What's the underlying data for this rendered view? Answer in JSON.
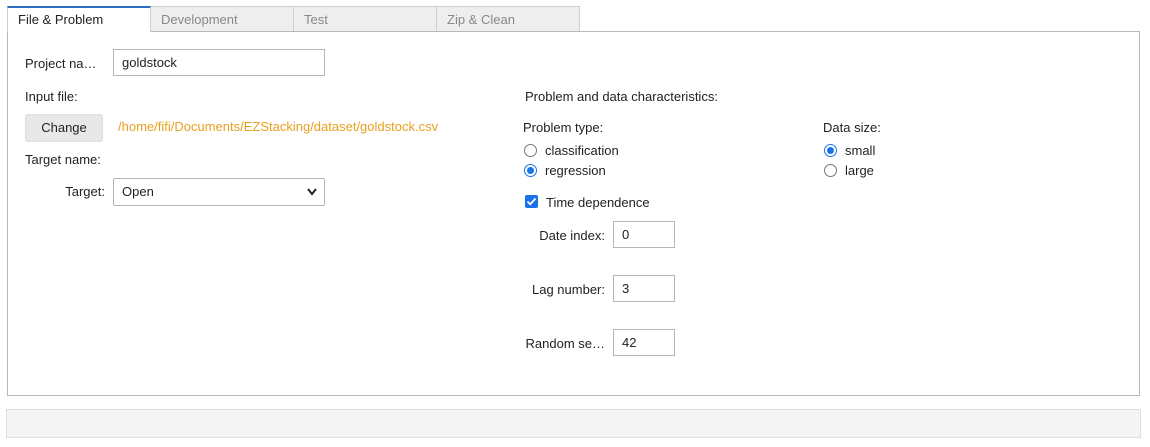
{
  "tabs": [
    {
      "label": "File & Problem",
      "active": true
    },
    {
      "label": "Development",
      "active": false
    },
    {
      "label": "Test",
      "active": false
    },
    {
      "label": "Zip & Clean",
      "active": false
    }
  ],
  "left": {
    "project_name_label": "Project na…",
    "project_name_value": "goldstock",
    "input_file_label": "Input file:",
    "change_button": "Change",
    "file_path": "/home/fifi/Documents/EZStacking/dataset/goldstock.csv",
    "target_name_label": "Target name:",
    "target_label": "Target:",
    "target_value": "Open"
  },
  "right": {
    "section_title": "Problem and data characteristics:",
    "problem_type_label": "Problem type:",
    "problem_types": [
      {
        "label": "classification",
        "selected": false
      },
      {
        "label": "regression",
        "selected": true
      }
    ],
    "data_size_label": "Data size:",
    "data_sizes": [
      {
        "label": "small",
        "selected": true
      },
      {
        "label": "large",
        "selected": false
      }
    ],
    "time_dependence_label": "Time dependence",
    "time_dependence_checked": true,
    "date_index_label": "Date index:",
    "date_index_value": "0",
    "lag_number_label": "Lag number:",
    "lag_number_value": "3",
    "random_seed_label": "Random se…",
    "random_seed_value": "42"
  },
  "colors": {
    "accent": "#1a73e8",
    "file_path": "#e8a020",
    "active_tab_border": "#2a6fbf"
  }
}
